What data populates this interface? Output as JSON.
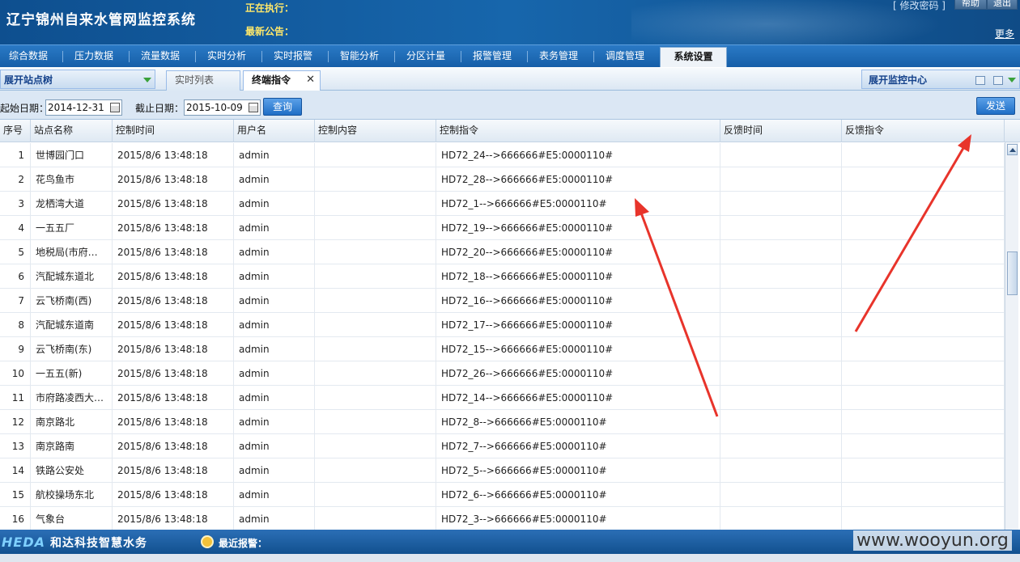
{
  "header": {
    "app_title": "辽宁锦州自来水管网监控系统",
    "executing_label": "正在执行：",
    "notice_label": "最新公告：",
    "change_password": "[ 修改密码 ]",
    "help": "帮助",
    "exit": "退出",
    "more": "更多"
  },
  "nav": {
    "items": [
      "综合数据",
      "压力数据",
      "流量数据",
      "实时分析",
      "实时报警",
      "智能分析",
      "分区计量",
      "报警管理",
      "表务管理",
      "调度管理",
      "系统设置"
    ],
    "active": "系统设置"
  },
  "tabs": {
    "tree_toggle": "展开站点树",
    "items": [
      "实时列表",
      "终端指令"
    ],
    "active": "终端指令",
    "close_glyph": "✕",
    "monitor_center": "展开监控中心"
  },
  "toolbar": {
    "start_label": "起始日期：",
    "start_value": "2014-12-31",
    "end_label": "截止日期：",
    "end_value": "2015-10-09",
    "query_button": "查询",
    "send_button": "发送"
  },
  "table": {
    "columns": [
      "序号",
      "站点名称",
      "控制时间",
      "用户名",
      "控制内容",
      "控制指令",
      "反馈时间",
      "反馈指令"
    ],
    "rows": [
      {
        "seq": "1",
        "site": "世博园门口",
        "time": "2015/8/6 13:48:18",
        "user": "admin",
        "content": "",
        "command": "HD72_24-->666666#E5:0000110#",
        "fb_time": "",
        "fb_cmd": ""
      },
      {
        "seq": "2",
        "site": "花鸟鱼市",
        "time": "2015/8/6 13:48:18",
        "user": "admin",
        "content": "",
        "command": "HD72_28-->666666#E5:0000110#",
        "fb_time": "",
        "fb_cmd": ""
      },
      {
        "seq": "3",
        "site": "龙栖湾大道",
        "time": "2015/8/6 13:48:18",
        "user": "admin",
        "content": "",
        "command": "HD72_1-->666666#E5:0000110#",
        "fb_time": "",
        "fb_cmd": ""
      },
      {
        "seq": "4",
        "site": "一五五厂",
        "time": "2015/8/6 13:48:18",
        "user": "admin",
        "content": "",
        "command": "HD72_19-->666666#E5:0000110#",
        "fb_time": "",
        "fb_cmd": ""
      },
      {
        "seq": "5",
        "site": "地税局(市府…",
        "time": "2015/8/6 13:48:18",
        "user": "admin",
        "content": "",
        "command": "HD72_20-->666666#E5:0000110#",
        "fb_time": "",
        "fb_cmd": ""
      },
      {
        "seq": "6",
        "site": "汽配城东道北",
        "time": "2015/8/6 13:48:18",
        "user": "admin",
        "content": "",
        "command": "HD72_18-->666666#E5:0000110#",
        "fb_time": "",
        "fb_cmd": ""
      },
      {
        "seq": "7",
        "site": "云飞桥南(西)",
        "time": "2015/8/6 13:48:18",
        "user": "admin",
        "content": "",
        "command": "HD72_16-->666666#E5:0000110#",
        "fb_time": "",
        "fb_cmd": ""
      },
      {
        "seq": "8",
        "site": "汽配城东道南",
        "time": "2015/8/6 13:48:18",
        "user": "admin",
        "content": "",
        "command": "HD72_17-->666666#E5:0000110#",
        "fb_time": "",
        "fb_cmd": ""
      },
      {
        "seq": "9",
        "site": "云飞桥南(东)",
        "time": "2015/8/6 13:48:18",
        "user": "admin",
        "content": "",
        "command": "HD72_15-->666666#E5:0000110#",
        "fb_time": "",
        "fb_cmd": ""
      },
      {
        "seq": "10",
        "site": "一五五(新)",
        "time": "2015/8/6 13:48:18",
        "user": "admin",
        "content": "",
        "command": "HD72_26-->666666#E5:0000110#",
        "fb_time": "",
        "fb_cmd": ""
      },
      {
        "seq": "11",
        "site": "市府路凌西大…",
        "time": "2015/8/6 13:48:18",
        "user": "admin",
        "content": "",
        "command": "HD72_14-->666666#E5:0000110#",
        "fb_time": "",
        "fb_cmd": ""
      },
      {
        "seq": "12",
        "site": "南京路北",
        "time": "2015/8/6 13:48:18",
        "user": "admin",
        "content": "",
        "command": "HD72_8-->666666#E5:0000110#",
        "fb_time": "",
        "fb_cmd": ""
      },
      {
        "seq": "13",
        "site": "南京路南",
        "time": "2015/8/6 13:48:18",
        "user": "admin",
        "content": "",
        "command": "HD72_7-->666666#E5:0000110#",
        "fb_time": "",
        "fb_cmd": ""
      },
      {
        "seq": "14",
        "site": "铁路公安处",
        "time": "2015/8/6 13:48:18",
        "user": "admin",
        "content": "",
        "command": "HD72_5-->666666#E5:0000110#",
        "fb_time": "",
        "fb_cmd": ""
      },
      {
        "seq": "15",
        "site": "航校操场东北",
        "time": "2015/8/6 13:48:18",
        "user": "admin",
        "content": "",
        "command": "HD72_6-->666666#E5:0000110#",
        "fb_time": "",
        "fb_cmd": ""
      },
      {
        "seq": "16",
        "site": "气象台",
        "time": "2015/8/6 13:48:18",
        "user": "admin",
        "content": "",
        "command": "HD72_3-->666666#E5:0000110#",
        "fb_time": "",
        "fb_cmd": ""
      }
    ]
  },
  "footer": {
    "logo": "HEDA",
    "company": "和达科技智慧水务",
    "recent_alarm": "最近报警：",
    "watermark": "www.wooyun.org"
  },
  "colors": {
    "header_blue": "#1766ac",
    "nav_blue": "#1f6bb8",
    "annotation_arrow": "#e8342b"
  },
  "icons": {
    "calendar": "calendar-icon",
    "close": "close-icon",
    "alarm": "alarm-icon",
    "dropdown": "chevron-down-icon"
  }
}
